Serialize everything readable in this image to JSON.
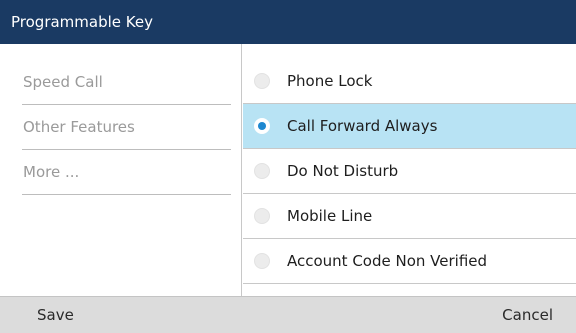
{
  "title": "Programmable Key",
  "categories": [
    {
      "label": "Speed Call"
    },
    {
      "label": "Other Features"
    },
    {
      "label": "More ..."
    }
  ],
  "options": [
    {
      "label": "Phone Lock",
      "selected": false
    },
    {
      "label": "Call Forward Always",
      "selected": true
    },
    {
      "label": "Do Not Disturb",
      "selected": false
    },
    {
      "label": "Mobile Line",
      "selected": false
    },
    {
      "label": "Account Code Non Verified",
      "selected": false
    }
  ],
  "softkeys": {
    "save": "Save",
    "cancel": "Cancel"
  },
  "colors": {
    "title_bar": "#1a3a63",
    "selected_row": "#b8e3f4",
    "radio_on": "#1e88d0",
    "softkey_bar": "#dcdcdc"
  }
}
